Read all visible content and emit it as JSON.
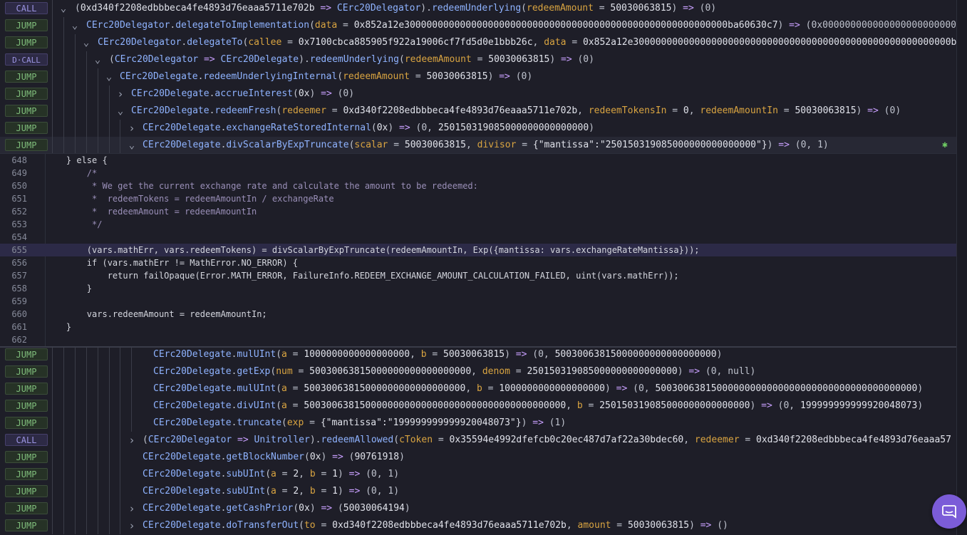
{
  "trace_top": [
    {
      "badge": "CALL",
      "parts": [
        [
          "op",
          "("
        ],
        [
          "val",
          "0xd340f2208edbbbeca4fe4893d76eaaa5711e702b"
        ],
        [
          "arrow",
          " => "
        ],
        [
          "cn",
          "CErc20Delegator"
        ],
        [
          "op",
          ")."
        ],
        [
          "fn",
          "redeemUnderlying"
        ],
        [
          "op",
          "("
        ],
        [
          "pn",
          "redeemAmount"
        ],
        [
          "op",
          " = "
        ],
        [
          "val",
          "50030063815"
        ],
        [
          "op",
          ")"
        ],
        [
          "arrow",
          " => "
        ],
        [
          "op",
          "(0)"
        ]
      ]
    },
    {
      "badge": "JUMP",
      "parts": [
        [
          "cn",
          "CErc20Delegator"
        ],
        [
          "op",
          "."
        ],
        [
          "fn",
          "delegateToImplementation"
        ],
        [
          "op",
          "("
        ],
        [
          "pn",
          "data"
        ],
        [
          "op",
          " = "
        ],
        [
          "val",
          "0x852a12e3000000000000000000000000000000000000000000000000000000000ba60630c7"
        ],
        [
          "op",
          ")"
        ],
        [
          "arrow",
          " => "
        ],
        [
          "op",
          "(0x00000000000000000000000000000000"
        ]
      ]
    },
    {
      "badge": "JUMP",
      "parts": [
        [
          "cn",
          "CErc20Delegator"
        ],
        [
          "op",
          "."
        ],
        [
          "fn",
          "delegateTo"
        ],
        [
          "op",
          "("
        ],
        [
          "pn",
          "callee"
        ],
        [
          "op",
          " = "
        ],
        [
          "val",
          "0x7100cbca885905f922a19006cf7fd5d0e1bbb26c"
        ],
        [
          "op",
          ", "
        ],
        [
          "pn",
          "data"
        ],
        [
          "op",
          " = "
        ],
        [
          "val",
          "0x852a12e300000000000000000000000000000000000000000000000000000000b"
        ]
      ]
    },
    {
      "badge": "D·CALL",
      "parts": [
        [
          "op",
          "("
        ],
        [
          "cn",
          "CErc20Delegator"
        ],
        [
          "arrow",
          " => "
        ],
        [
          "cn",
          "CErc20Delegate"
        ],
        [
          "op",
          ")."
        ],
        [
          "fn",
          "redeemUnderlying"
        ],
        [
          "op",
          "("
        ],
        [
          "pn",
          "redeemAmount"
        ],
        [
          "op",
          " = "
        ],
        [
          "val",
          "50030063815"
        ],
        [
          "op",
          ")"
        ],
        [
          "arrow",
          " => "
        ],
        [
          "op",
          "(0)"
        ]
      ]
    },
    {
      "badge": "JUMP",
      "parts": [
        [
          "cn",
          "CErc20Delegate"
        ],
        [
          "op",
          "."
        ],
        [
          "fn",
          "redeemUnderlyingInternal"
        ],
        [
          "op",
          "("
        ],
        [
          "pn",
          "redeemAmount"
        ],
        [
          "op",
          " = "
        ],
        [
          "val",
          "50030063815"
        ],
        [
          "op",
          ")"
        ],
        [
          "arrow",
          " => "
        ],
        [
          "op",
          "(0)"
        ]
      ]
    },
    {
      "badge": "JUMP",
      "parts": [
        [
          "cn",
          "CErc20Delegate"
        ],
        [
          "op",
          "."
        ],
        [
          "fn",
          "accrueInterest"
        ],
        [
          "op",
          "("
        ],
        [
          "val",
          "0x"
        ],
        [
          "op",
          ")"
        ],
        [
          "arrow",
          " => "
        ],
        [
          "op",
          "(0)"
        ]
      ]
    },
    {
      "badge": "JUMP",
      "parts": [
        [
          "cn",
          "CErc20Delegate"
        ],
        [
          "op",
          "."
        ],
        [
          "fn",
          "redeemFresh"
        ],
        [
          "op",
          "("
        ],
        [
          "pn",
          "redeemer"
        ],
        [
          "op",
          " = "
        ],
        [
          "val",
          "0xd340f2208edbbbeca4fe4893d76eaaa5711e702b"
        ],
        [
          "op",
          ", "
        ],
        [
          "pn",
          "redeemTokensIn"
        ],
        [
          "op",
          " = "
        ],
        [
          "val",
          "0"
        ],
        [
          "op",
          ", "
        ],
        [
          "pn",
          "redeemAmountIn"
        ],
        [
          "op",
          " = "
        ],
        [
          "val",
          "50030063815"
        ],
        [
          "op",
          ")"
        ],
        [
          "arrow",
          " => "
        ],
        [
          "op",
          "(0)"
        ]
      ]
    },
    {
      "badge": "JUMP",
      "parts": [
        [
          "cn",
          "CErc20Delegate"
        ],
        [
          "op",
          "."
        ],
        [
          "fn",
          "exchangeRateStoredInternal"
        ],
        [
          "op",
          "("
        ],
        [
          "val",
          "0x"
        ],
        [
          "op",
          ")"
        ],
        [
          "arrow",
          " => "
        ],
        [
          "op",
          "(0, "
        ],
        [
          "val",
          "250150319085000000000000000"
        ],
        [
          "op",
          ")"
        ]
      ]
    },
    {
      "badge": "JUMP",
      "parts": [
        [
          "cn",
          "CErc20Delegate"
        ],
        [
          "op",
          "."
        ],
        [
          "fn",
          "divScalarByExpTruncate"
        ],
        [
          "op",
          "("
        ],
        [
          "pn",
          "scalar"
        ],
        [
          "op",
          " = "
        ],
        [
          "val",
          "50030063815"
        ],
        [
          "op",
          ", "
        ],
        [
          "pn",
          "divisor"
        ],
        [
          "op",
          " = "
        ],
        [
          "val",
          "{\"mantissa\":\"250150319085000000000000000\"}"
        ],
        [
          "op",
          ")"
        ],
        [
          "arrow",
          " => "
        ],
        [
          "op",
          "(0, 1)"
        ]
      ]
    }
  ],
  "code_lines": [
    {
      "n": "648",
      "t": "    } else {"
    },
    {
      "n": "649",
      "t": "        /*"
    },
    {
      "n": "650",
      "t": "         * We get the current exchange rate and calculate the amount to be redeemed:"
    },
    {
      "n": "651",
      "t": "         *  redeemTokens = redeemAmountIn / exchangeRate"
    },
    {
      "n": "652",
      "t": "         *  redeemAmount = redeemAmountIn"
    },
    {
      "n": "653",
      "t": "         */"
    },
    {
      "n": "654",
      "t": ""
    },
    {
      "n": "655",
      "t": "        (vars.mathErr, vars.redeemTokens) = divScalarByExpTruncate(redeemAmountIn, Exp({mantissa: vars.exchangeRateMantissa}));"
    },
    {
      "n": "656",
      "t": "        if (vars.mathErr != MathError.NO_ERROR) {"
    },
    {
      "n": "657",
      "t": "            return failOpaque(Error.MATH_ERROR, FailureInfo.REDEEM_EXCHANGE_AMOUNT_CALCULATION_FAILED, uint(vars.mathErr));"
    },
    {
      "n": "658",
      "t": "        }"
    },
    {
      "n": "659",
      "t": ""
    },
    {
      "n": "660",
      "t": "        vars.redeemAmount = redeemAmountIn;"
    },
    {
      "n": "661",
      "t": "    }"
    },
    {
      "n": "662",
      "t": ""
    }
  ],
  "trace_bottom": [
    {
      "badge": "JUMP",
      "parts": [
        [
          "cn",
          "CErc20Delegate"
        ],
        [
          "op",
          "."
        ],
        [
          "fn",
          "mulUInt"
        ],
        [
          "op",
          "("
        ],
        [
          "pn",
          "a"
        ],
        [
          "op",
          " = "
        ],
        [
          "val",
          "1000000000000000000"
        ],
        [
          "op",
          ", "
        ],
        [
          "pn",
          "b"
        ],
        [
          "op",
          " = "
        ],
        [
          "val",
          "50030063815"
        ],
        [
          "op",
          ")"
        ],
        [
          "arrow",
          " => "
        ],
        [
          "op",
          "(0, "
        ],
        [
          "val",
          "50030063815000000000000000000"
        ],
        [
          "op",
          ")"
        ]
      ]
    },
    {
      "badge": "JUMP",
      "parts": [
        [
          "cn",
          "CErc20Delegate"
        ],
        [
          "op",
          "."
        ],
        [
          "fn",
          "getExp"
        ],
        [
          "op",
          "("
        ],
        [
          "pn",
          "num"
        ],
        [
          "op",
          " = "
        ],
        [
          "val",
          "50030063815000000000000000000"
        ],
        [
          "op",
          ", "
        ],
        [
          "pn",
          "denom"
        ],
        [
          "op",
          " = "
        ],
        [
          "val",
          "250150319085000000000000000"
        ],
        [
          "op",
          ")"
        ],
        [
          "arrow",
          " => "
        ],
        [
          "op",
          "(0, null)"
        ]
      ]
    },
    {
      "badge": "JUMP",
      "parts": [
        [
          "cn",
          "CErc20Delegate"
        ],
        [
          "op",
          "."
        ],
        [
          "fn",
          "mulUInt"
        ],
        [
          "op",
          "("
        ],
        [
          "pn",
          "a"
        ],
        [
          "op",
          " = "
        ],
        [
          "val",
          "50030063815000000000000000000"
        ],
        [
          "op",
          ", "
        ],
        [
          "pn",
          "b"
        ],
        [
          "op",
          " = "
        ],
        [
          "val",
          "1000000000000000000"
        ],
        [
          "op",
          ")"
        ],
        [
          "arrow",
          " => "
        ],
        [
          "op",
          "(0, "
        ],
        [
          "val",
          "50030063815000000000000000000000000000000000000"
        ],
        [
          "op",
          ")"
        ]
      ]
    },
    {
      "badge": "JUMP",
      "parts": [
        [
          "cn",
          "CErc20Delegate"
        ],
        [
          "op",
          "."
        ],
        [
          "fn",
          "divUInt"
        ],
        [
          "op",
          "("
        ],
        [
          "pn",
          "a"
        ],
        [
          "op",
          " = "
        ],
        [
          "val",
          "50030063815000000000000000000000000000000000000"
        ],
        [
          "op",
          ", "
        ],
        [
          "pn",
          "b"
        ],
        [
          "op",
          " = "
        ],
        [
          "val",
          "250150319085000000000000000"
        ],
        [
          "op",
          ")"
        ],
        [
          "arrow",
          " => "
        ],
        [
          "op",
          "(0, "
        ],
        [
          "val",
          "199999999999920048073"
        ],
        [
          "op",
          ")"
        ]
      ]
    },
    {
      "badge": "JUMP",
      "parts": [
        [
          "cn",
          "CErc20Delegate"
        ],
        [
          "op",
          "."
        ],
        [
          "fn",
          "truncate"
        ],
        [
          "op",
          "("
        ],
        [
          "pn",
          "exp"
        ],
        [
          "op",
          " = "
        ],
        [
          "val",
          "{\"mantissa\":\"199999999999920048073\"}"
        ],
        [
          "op",
          ")"
        ],
        [
          "arrow",
          " => "
        ],
        [
          "op",
          "(1)"
        ]
      ]
    },
    {
      "badge": "CALL",
      "parts": [
        [
          "op",
          "("
        ],
        [
          "cn",
          "CErc20Delegator"
        ],
        [
          "arrow",
          " => "
        ],
        [
          "cn",
          "Unitroller"
        ],
        [
          "op",
          ")."
        ],
        [
          "fn",
          "redeemAllowed"
        ],
        [
          "op",
          "("
        ],
        [
          "pn",
          "cToken"
        ],
        [
          "op",
          " = "
        ],
        [
          "val",
          "0x35594e4992dfefcb0c20ec487d7af22a30bdec60"
        ],
        [
          "op",
          ", "
        ],
        [
          "pn",
          "redeemer"
        ],
        [
          "op",
          " = "
        ],
        [
          "val",
          "0xd340f2208edbbbeca4fe4893d76eaaa57"
        ]
      ]
    },
    {
      "badge": "JUMP",
      "parts": [
        [
          "cn",
          "CErc20Delegate"
        ],
        [
          "op",
          "."
        ],
        [
          "fn",
          "getBlockNumber"
        ],
        [
          "op",
          "("
        ],
        [
          "val",
          "0x"
        ],
        [
          "op",
          ")"
        ],
        [
          "arrow",
          " => "
        ],
        [
          "op",
          "("
        ],
        [
          "val",
          "90761918"
        ],
        [
          "op",
          ")"
        ]
      ]
    },
    {
      "badge": "JUMP",
      "parts": [
        [
          "cn",
          "CErc20Delegate"
        ],
        [
          "op",
          "."
        ],
        [
          "fn",
          "subUInt"
        ],
        [
          "op",
          "("
        ],
        [
          "pn",
          "a"
        ],
        [
          "op",
          " = "
        ],
        [
          "val",
          "2"
        ],
        [
          "op",
          ", "
        ],
        [
          "pn",
          "b"
        ],
        [
          "op",
          " = "
        ],
        [
          "val",
          "1"
        ],
        [
          "op",
          ")"
        ],
        [
          "arrow",
          " => "
        ],
        [
          "op",
          "(0, 1)"
        ]
      ]
    },
    {
      "badge": "JUMP",
      "parts": [
        [
          "cn",
          "CErc20Delegate"
        ],
        [
          "op",
          "."
        ],
        [
          "fn",
          "subUInt"
        ],
        [
          "op",
          "("
        ],
        [
          "pn",
          "a"
        ],
        [
          "op",
          " = "
        ],
        [
          "val",
          "2"
        ],
        [
          "op",
          ", "
        ],
        [
          "pn",
          "b"
        ],
        [
          "op",
          " = "
        ],
        [
          "val",
          "1"
        ],
        [
          "op",
          ")"
        ],
        [
          "arrow",
          " => "
        ],
        [
          "op",
          "(0, 1)"
        ]
      ]
    },
    {
      "badge": "JUMP",
      "parts": [
        [
          "cn",
          "CErc20Delegate"
        ],
        [
          "op",
          "."
        ],
        [
          "fn",
          "getCashPrior"
        ],
        [
          "op",
          "("
        ],
        [
          "val",
          "0x"
        ],
        [
          "op",
          ")"
        ],
        [
          "arrow",
          " => "
        ],
        [
          "op",
          "("
        ],
        [
          "val",
          "50030064194"
        ],
        [
          "op",
          ")"
        ]
      ]
    },
    {
      "badge": "JUMP",
      "parts": [
        [
          "cn",
          "CErc20Delegate"
        ],
        [
          "op",
          "."
        ],
        [
          "fn",
          "doTransferOut"
        ],
        [
          "op",
          "("
        ],
        [
          "pn",
          "to"
        ],
        [
          "op",
          " = "
        ],
        [
          "val",
          "0xd340f2208edbbbeca4fe4893d76eaaa5711e702b"
        ],
        [
          "op",
          ", "
        ],
        [
          "pn",
          "amount"
        ],
        [
          "op",
          " = "
        ],
        [
          "val",
          "50030063815"
        ],
        [
          "op",
          ")"
        ],
        [
          "arrow",
          " => "
        ],
        [
          "op",
          "()"
        ]
      ]
    }
  ],
  "icons": {
    "debug": "bug-icon",
    "chat": "chat-bubble-icon",
    "expand": "chevron-down-icon",
    "collapse": "chevron-right-icon"
  }
}
